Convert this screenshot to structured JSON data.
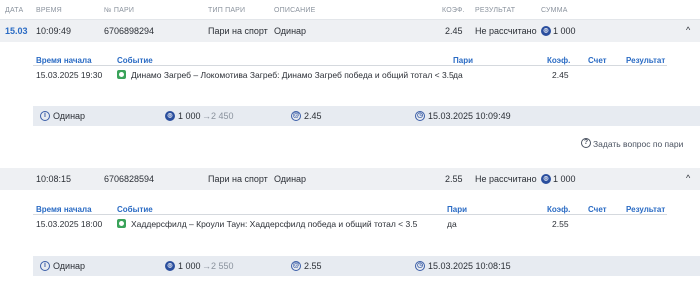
{
  "header": {
    "date": "ДАТА",
    "time": "ВРЕМЯ",
    "bet_no": "№ ПАРИ",
    "bet_type": "ТИП ПАРИ",
    "description": "ОПИСАНИЕ",
    "coef": "КОЭФ.",
    "result": "РЕЗУЛЬТАТ",
    "amount": "СУММА"
  },
  "bets": [
    {
      "date": "15.03",
      "time": "10:09:49",
      "number": "6706898294",
      "type": "Пари на спорт",
      "description": "Одинар",
      "coef": "2.45",
      "result": "Не рассчитано",
      "amount": "1 000",
      "details": {
        "h_start": "Время начала",
        "h_event": "Событие",
        "h_bet": "Пари",
        "h_coef": "Коэф.",
        "h_score": "Счет",
        "h_result": "Результат",
        "start": "15.03.2025 19:30",
        "event": "Динамо Загреб – Локомотива Загреб: Динамо Загреб победа и общий тотал < 3.5",
        "bet": "да",
        "coef": "2.45"
      },
      "summary": {
        "type": "Одинар",
        "stake": "1 000",
        "win": "2 450",
        "coef": "2.45",
        "datetime": "15.03.2025 10:09:49"
      },
      "ask_label": "Задать вопрос по пари"
    },
    {
      "date": "",
      "time": "10:08:15",
      "number": "6706828594",
      "type": "Пари на спорт",
      "description": "Одинар",
      "coef": "2.55",
      "result": "Не рассчитано",
      "amount": "1 000",
      "details": {
        "h_start": "Время начала",
        "h_event": "Событие",
        "h_bet": "Пари",
        "h_coef": "Коэф.",
        "h_score": "Счет",
        "h_result": "Результат",
        "start": "15.03.2025 18:00",
        "event": "Хаддерсфилд – Кроули Таун: Хаддерсфилд победа и общий тотал < 3.5",
        "bet": "да",
        "coef": "2.55"
      },
      "summary": {
        "type": "Одинар",
        "stake": "1 000",
        "win": "2 550",
        "coef": "2.55",
        "datetime": "15.03.2025 10:08:15"
      }
    }
  ],
  "icons": {
    "arrow": "→",
    "chevron": "^"
  },
  "colors": {
    "accent": "#2a6bc4",
    "row_bg": "#eef0f3",
    "summary_bg": "#e7ebf1",
    "icon": "#2b4f9e",
    "sport_icon": "#3aa35a"
  }
}
